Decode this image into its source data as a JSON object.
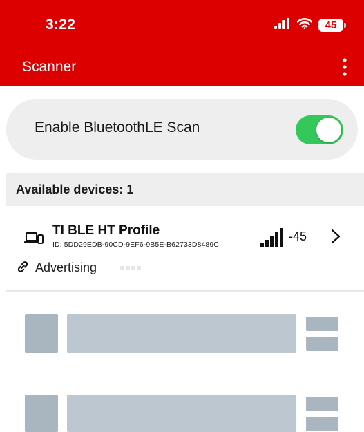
{
  "status_bar": {
    "time": "3:22",
    "battery": "45",
    "icons": [
      "signal-bars-icon",
      "wifi-icon",
      "battery-icon"
    ]
  },
  "app_bar": {
    "title": "Scanner",
    "menu_icon": "more-vertical-icon"
  },
  "scan": {
    "label": "Enable BluetoothLE Scan",
    "enabled": true
  },
  "devices": {
    "header": "Available devices: 1",
    "items": [
      {
        "name": "TI BLE HT Profile",
        "id": "ID: 5DD29EDB-90CD-9EF6-9B5E-B62733D8489C",
        "rssi": "-45",
        "status": "Advertising"
      }
    ]
  },
  "colors": {
    "brand": "#dd0000",
    "toggle_on": "#34c759",
    "card_bg": "#eeeeee",
    "skeleton": "#a9b5bf"
  }
}
